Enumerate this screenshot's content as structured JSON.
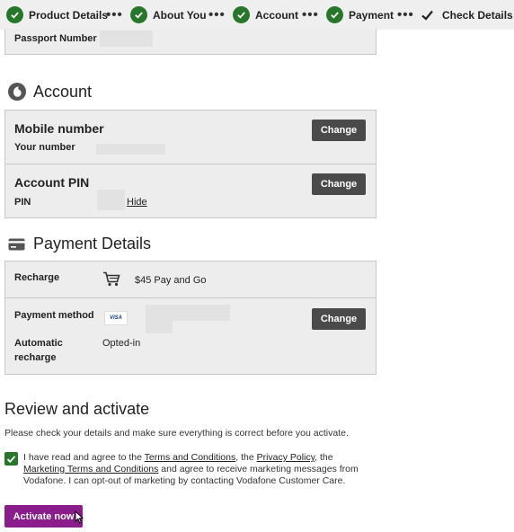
{
  "stepper": {
    "steps": [
      {
        "label": "Product Details",
        "state": "done"
      },
      {
        "label": "About You",
        "state": "done"
      },
      {
        "label": "Account",
        "state": "done"
      },
      {
        "label": "Payment",
        "state": "done"
      },
      {
        "label": "Check Details",
        "state": "current"
      }
    ],
    "separator": "•••"
  },
  "passport": {
    "label": "Passport Number"
  },
  "account": {
    "heading": "Account",
    "mobile": {
      "title": "Mobile number",
      "label": "Your number",
      "button": "Change"
    },
    "pin": {
      "title": "Account PIN",
      "label": "PIN",
      "hide_link": "Hide",
      "button": "Change"
    }
  },
  "payment": {
    "heading": "Payment Details",
    "recharge": {
      "label": "Recharge",
      "value": "$45 Pay and Go"
    },
    "method": {
      "label": "Payment method",
      "card_brand": "VISA",
      "button": "Change"
    },
    "auto": {
      "label_line1": "Automatic",
      "label_line2": "recharge",
      "value": "Opted-in"
    }
  },
  "review": {
    "heading": "Review and activate",
    "instructions": "Please check your details and make sure everything is correct before you activate.",
    "consent": {
      "t1": "I have read and agree to the ",
      "link1": "Terms and Conditions",
      "t2": ", the ",
      "link2": "Privacy Policy",
      "t3": ", the ",
      "link3": "Marketing Terms and Conditions",
      "t4": " and agree to receive marketing messages from Vodafone. I can opt-out of marketing by contacting Vodafone Customer Care."
    },
    "activate_button": "Activate now"
  },
  "colors": {
    "success": "#27772a",
    "accent": "#8a1c8c",
    "button_dark": "#4a4a4a"
  }
}
